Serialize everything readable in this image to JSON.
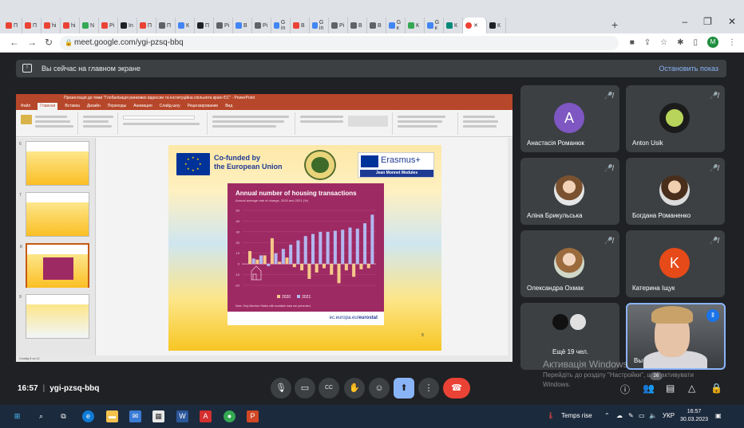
{
  "browser": {
    "tabs": [
      "П",
      "П",
      "hi",
      "hi",
      "N",
      "Pi",
      "In",
      "П",
      "П",
      "К",
      "П",
      "Pi",
      "В",
      "Pi",
      "G in",
      "В",
      "G in",
      "Pi",
      "В",
      "В",
      "G к",
      "К",
      "G к",
      "К",
      "К"
    ],
    "url": "meet.google.com/ygi-pzsq-bbq",
    "profile_initial": "M"
  },
  "meet": {
    "presenting_text": "Вы сейчас на главном экране",
    "stop_text": "Остановить показ",
    "time": "16:57",
    "meeting_code": "ygi-pzsq-bbq",
    "participants_badge": "26",
    "participants": [
      {
        "name": "Анастасія Романюк",
        "initial": "A",
        "color": "#7e57c2"
      },
      {
        "name": "Anton Usik",
        "initial": "",
        "color": "#1b1b1b"
      },
      {
        "name": "Аліна Брикульська",
        "initial": "",
        "color": ""
      },
      {
        "name": "Богдана Романенко",
        "initial": "",
        "color": ""
      },
      {
        "name": "Олександра Охмак",
        "initial": "",
        "color": ""
      },
      {
        "name": "Катерина Іщук",
        "initial": "K",
        "color": "#e64a19"
      }
    ],
    "more_text": "Ещё 19 чел.",
    "self_name": "Вы",
    "activation_title": "Активація Windows",
    "activation_sub": "Перейдіть до розділу \"Настройки\", щоб активувати Windows."
  },
  "ppt": {
    "title_bar": "Презентація до теми \"Глобалізація ринкових відносин та інституційна спільнота країн ЄС\" - PowerPoint",
    "menu": [
      "Файл",
      "Главная",
      "Вставка",
      "Дизайн",
      "Переходы",
      "Анимация",
      "Слайд-шоу",
      "Рецензирование",
      "Вид"
    ],
    "active_menu": "Главная",
    "status": "Слайд 8 из 11",
    "thumb_numbers": [
      "6",
      "7",
      "8",
      "9"
    ]
  },
  "slide": {
    "cofunded_line1": "Co-funded by",
    "cofunded_line2": "the European Union",
    "erasmus": "Erasmus+",
    "jean_monnet": "Jean Monnet Modules",
    "source_text": "ec.europa.eu/",
    "source_bold": "eurostat",
    "page_number": "8"
  },
  "chart_data": {
    "type": "bar",
    "title": "Annual number of housing transactions",
    "subtitle": "Annual average rate of change, 2020 and 2021 (%)",
    "note": "Note: Only Member States with available data are presented.",
    "ylim": [
      -20,
      50
    ],
    "categories": [
      "",
      "",
      "",
      "",
      "",
      "",
      "",
      "",
      "",
      "",
      "",
      "",
      "",
      "",
      "",
      "",
      ""
    ],
    "series": [
      {
        "name": "2020",
        "color": "#f6c98a",
        "values": [
          12,
          4,
          8,
          24,
          2,
          6,
          -3,
          -6,
          -14,
          -8,
          -4,
          -10,
          -18,
          -6,
          -12,
          -5,
          -4
        ]
      },
      {
        "name": "2021",
        "color": "#b3b8f0",
        "values": [
          5,
          8,
          -2,
          10,
          14,
          18,
          22,
          26,
          28,
          30,
          30,
          31,
          32,
          34,
          33,
          38,
          46
        ]
      }
    ]
  },
  "taskbar": {
    "weather": "Temps rise",
    "lang": "УКР",
    "time": "16:57",
    "date": "30.03.2023"
  }
}
